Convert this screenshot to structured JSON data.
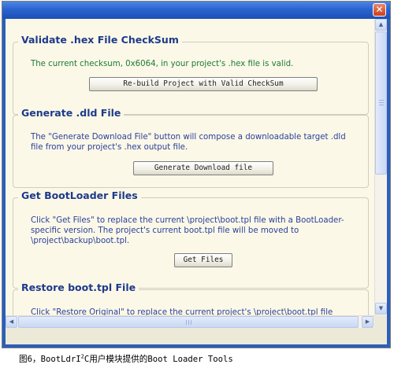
{
  "window": {
    "close_glyph": "✕"
  },
  "sections": {
    "checksum": {
      "title": "Validate .hex File CheckSum",
      "text": "The current checksum, 0x6064, in your project's .hex file is valid.",
      "button": "Re-build Project with Valid CheckSum"
    },
    "dld": {
      "title": "Generate .dld File",
      "text_line1": "The \"Generate Download File\" button will compose a downloadable target .dld",
      "text_line2": "file from your project's .hex output file.",
      "button": "Generate Download file"
    },
    "bootloader": {
      "title": "Get BootLoader Files",
      "text_line1": "Click \"Get Files\" to replace the current \\project\\boot.tpl file with a BootLoader-",
      "text_line2": "specific version. The project's current boot.tpl file will be moved to",
      "text_line3": "\\project\\backup\\boot.tpl.",
      "button": "Get Files"
    },
    "restore": {
      "title": "Restore boot.tpl File",
      "text_line1": "Click \"Restore Original\" to replace the current project's \\project\\boot.tpl file"
    }
  },
  "scrollbars": {
    "up_glyph": "▲",
    "down_glyph": "▼",
    "left_glyph": "◀",
    "right_glyph": "▶"
  },
  "caption": {
    "prefix": "图6，BootLdrI",
    "superscript": "2",
    "suffix": "C用户模块提供的Boot Loader Tools"
  },
  "colors": {
    "titlebar": "#2a63cf",
    "heading": "#1e3a8a",
    "body_text": "#2a3f9a",
    "valid_text": "#1c7a33",
    "panel_bg": "#fbf8e8"
  }
}
